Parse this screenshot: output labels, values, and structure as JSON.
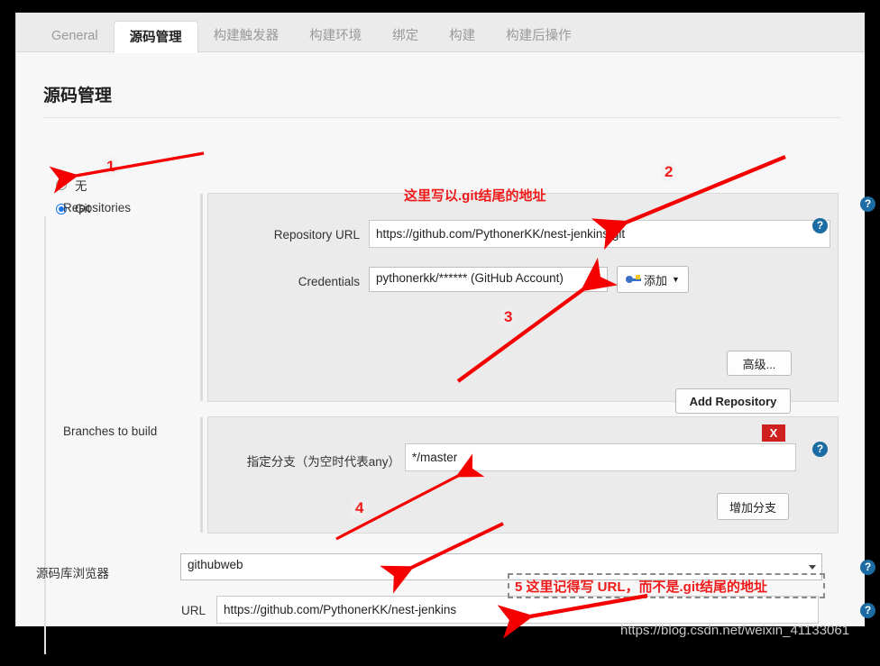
{
  "tabs": [
    {
      "label": "General",
      "active": false
    },
    {
      "label": "源码管理",
      "active": true
    },
    {
      "label": "构建触发器",
      "active": false
    },
    {
      "label": "构建环境",
      "active": false
    },
    {
      "label": "绑定",
      "active": false
    },
    {
      "label": "构建",
      "active": false
    },
    {
      "label": "构建后操作",
      "active": false
    }
  ],
  "page": {
    "title": "源码管理",
    "watermark": "https://blog.csdn.net/weixin_41133061"
  },
  "scm": {
    "options": [
      {
        "label": "无",
        "selected": false
      },
      {
        "label": "Git",
        "selected": true
      }
    ]
  },
  "repositories": {
    "section_label": "Repositories",
    "url_label": "Repository URL",
    "url_value": "https://github.com/PythonerKK/nest-jenkins.git",
    "credentials_label": "Credentials",
    "credentials_value": "pythonerkk/****** (GitHub Account)",
    "add_credentials_label": "添加",
    "advanced_label": "高级...",
    "add_repository_label": "Add Repository"
  },
  "branches": {
    "section_label": "Branches to build",
    "branch_label": "指定分支（为空时代表any）",
    "branch_value": "*/master",
    "delete_label": "X",
    "add_branch_label": "增加分支"
  },
  "browser": {
    "section_label": "源码库浏览器",
    "selected": "githubweb",
    "url_label": "URL",
    "url_value": "https://github.com/PythonerKK/nest-jenkins"
  },
  "help_icons": {
    "glyph": "?"
  },
  "annotations": {
    "n1": "1",
    "n2": "2",
    "n3": "3",
    "n4": "4",
    "note_git_suffix": "这里写以.git结尾的地址",
    "note_url": "5 这里记得写 URL，而不是.git结尾的地址"
  },
  "colors": {
    "accent_red": "#ef1b1b",
    "help_blue": "#1c6ca4",
    "radio_blue": "#1a73e8",
    "delete_red": "#cf2020"
  }
}
